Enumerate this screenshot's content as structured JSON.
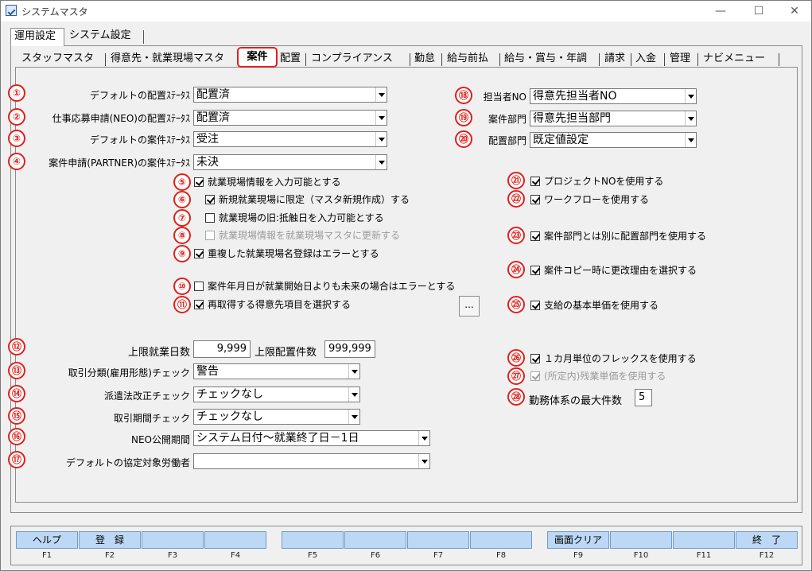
{
  "window": {
    "title": "システムマスタ",
    "minimize": "—",
    "maximize": "☐",
    "close": "✕"
  },
  "outer_tabs": [
    "運用設定",
    "システム設定"
  ],
  "inner_tabs": [
    "スタッフマスタ",
    "得意先・就業現場マスタ",
    "案件",
    "配置",
    "コンプライアンス",
    "勤怠",
    "給与前払",
    "給与・賞与・年調",
    "請求",
    "入金",
    "管理",
    "ナビメニュー"
  ],
  "active_inner_tab": "案件",
  "badges": [
    "①",
    "②",
    "③",
    "④",
    "⑤",
    "⑥",
    "⑦",
    "⑧",
    "⑨",
    "⑩",
    "⑪",
    "⑫",
    "⑬",
    "⑭",
    "⑮",
    "⑯",
    "⑰",
    "⑱",
    "⑲",
    "⑳",
    "㉑",
    "㉒",
    "㉓",
    "㉔",
    "㉕",
    "㉖",
    "㉗",
    "㉘"
  ],
  "left_settings": [
    {
      "label": "デフォルトの配置ｽﾃｰﾀｽ",
      "value": "配置済"
    },
    {
      "label": "仕事応募申請(NEO)の配置ｽﾃｰﾀｽ",
      "value": "配置済"
    },
    {
      "label": "デフォルトの案件ｽﾃｰﾀｽ",
      "value": "受注"
    },
    {
      "label": "案件申請(PARTNER)の案件ｽﾃｰﾀｽ",
      "value": "未決"
    }
  ],
  "right_settings": [
    {
      "label": "担当者NO",
      "value": "得意先担当者NO"
    },
    {
      "label": "案件部門",
      "value": "得意先担当部門"
    },
    {
      "label": "配置部門",
      "value": "既定値設定"
    }
  ],
  "middle_checkboxes": [
    {
      "label": "就業現場情報を入力可能とする",
      "checked": true,
      "disabled": false
    },
    {
      "label": "新規就業現場に限定（マスタ新規作成）する",
      "checked": true,
      "disabled": false
    },
    {
      "label": "就業現場の旧:抵触日を入力可能とする",
      "checked": false,
      "disabled": false
    },
    {
      "label": "就業現場情報を就業現場マスタに更新する",
      "checked": false,
      "disabled": true
    },
    {
      "label": "重複した就業現場名登録はエラーとする",
      "checked": true,
      "disabled": false
    },
    {
      "label": "案件年月日が就業開始日よりも未来の場合はエラーとする",
      "checked": false,
      "disabled": false
    },
    {
      "label": "再取得する得意先項目を選択する",
      "checked": true,
      "disabled": false
    }
  ],
  "ellipsis_button": "...",
  "right_checkboxes": [
    {
      "label": "プロジェクトNOを使用する",
      "checked": true,
      "disabled": false
    },
    {
      "label": "ワークフローを使用する",
      "checked": true,
      "disabled": false
    },
    {
      "label": "案件部門とは別に配置部門を使用する",
      "checked": true,
      "disabled": false
    },
    {
      "label": "案件コピー時に更改理由を選択する",
      "checked": true,
      "disabled": false
    },
    {
      "label": "支給の基本単価を使用する",
      "checked": true,
      "disabled": false
    },
    {
      "label": "１カ月単位のフレックスを使用する",
      "checked": true,
      "disabled": false
    },
    {
      "label": "(所定内)残業単価を使用する",
      "checked": true,
      "disabled": true
    }
  ],
  "limits": {
    "work_days_label": "上限就業日数",
    "work_days_value": "9,999",
    "placement_label": "上限配置件数",
    "placement_value": "999,999"
  },
  "lower_settings": [
    {
      "label": "取引分類(雇用形態)チェック",
      "value": "警告"
    },
    {
      "label": "派遣法改正チェック",
      "value": "チェックなし"
    },
    {
      "label": "取引期間チェック",
      "value": "チェックなし"
    },
    {
      "label": "NEO公開期間",
      "value": "システム日付〜就業終了日－1日"
    },
    {
      "label": "デフォルトの協定対象労働者",
      "value": ""
    }
  ],
  "max_work_systems": {
    "label": "勤務体系の最大件数",
    "value": "5"
  },
  "function_keys": [
    {
      "key": "F1",
      "label": "ヘルプ"
    },
    {
      "key": "F2",
      "label": "登　録"
    },
    {
      "key": "F3",
      "label": ""
    },
    {
      "key": "F4",
      "label": ""
    },
    {
      "key": "F5",
      "label": ""
    },
    {
      "key": "F6",
      "label": ""
    },
    {
      "key": "F7",
      "label": ""
    },
    {
      "key": "F8",
      "label": ""
    },
    {
      "key": "F9",
      "label": "画面クリア"
    },
    {
      "key": "F10",
      "label": ""
    },
    {
      "key": "F11",
      "label": ""
    },
    {
      "key": "F12",
      "label": "終　了"
    }
  ],
  "colors": {
    "badge": "#e0201c",
    "fkey": "#bcd8f4",
    "panel": "#f0f0f0"
  }
}
